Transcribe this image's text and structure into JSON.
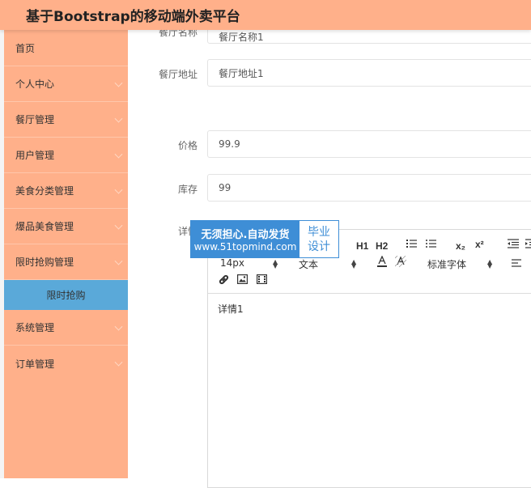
{
  "header": {
    "title": "基于Bootstrap的移动端外卖平台"
  },
  "sidebar": {
    "items": [
      {
        "label": "首页",
        "has_chevron": false
      },
      {
        "label": "个人中心",
        "has_chevron": true
      },
      {
        "label": "餐厅管理",
        "has_chevron": true
      },
      {
        "label": "用户管理",
        "has_chevron": true
      },
      {
        "label": "美食分类管理",
        "has_chevron": true
      },
      {
        "label": "爆品美食管理",
        "has_chevron": true
      },
      {
        "label": "限时抢购管理",
        "has_chevron": true
      },
      {
        "label": "系统管理",
        "has_chevron": true
      },
      {
        "label": "订单管理",
        "has_chevron": true
      }
    ],
    "active_sub": "限时抢购"
  },
  "form": {
    "partial": {
      "label": "餐厅名称",
      "value": "餐厅名称1"
    },
    "address": {
      "label": "餐厅地址",
      "value": "餐厅地址1"
    },
    "price": {
      "label": "价格",
      "value": "99.9"
    },
    "stock": {
      "label": "库存",
      "value": "99"
    },
    "detail": {
      "label": "详情"
    }
  },
  "editor": {
    "heading1": "H1",
    "heading2": "H2",
    "subscript": "x₂",
    "superscript": "x²",
    "font_size": "14px",
    "paragraph": "文本",
    "font_family": "标准字体",
    "content": "详情1"
  },
  "watermark": {
    "line1": "无须担心.自动发货",
    "line2": "www.51topmind.com",
    "badge1": "毕业",
    "badge2": "设计"
  },
  "colors": {
    "sidebar": "#ffb08a",
    "active": "#5aa9d9",
    "watermark": "#3e8ed6"
  }
}
